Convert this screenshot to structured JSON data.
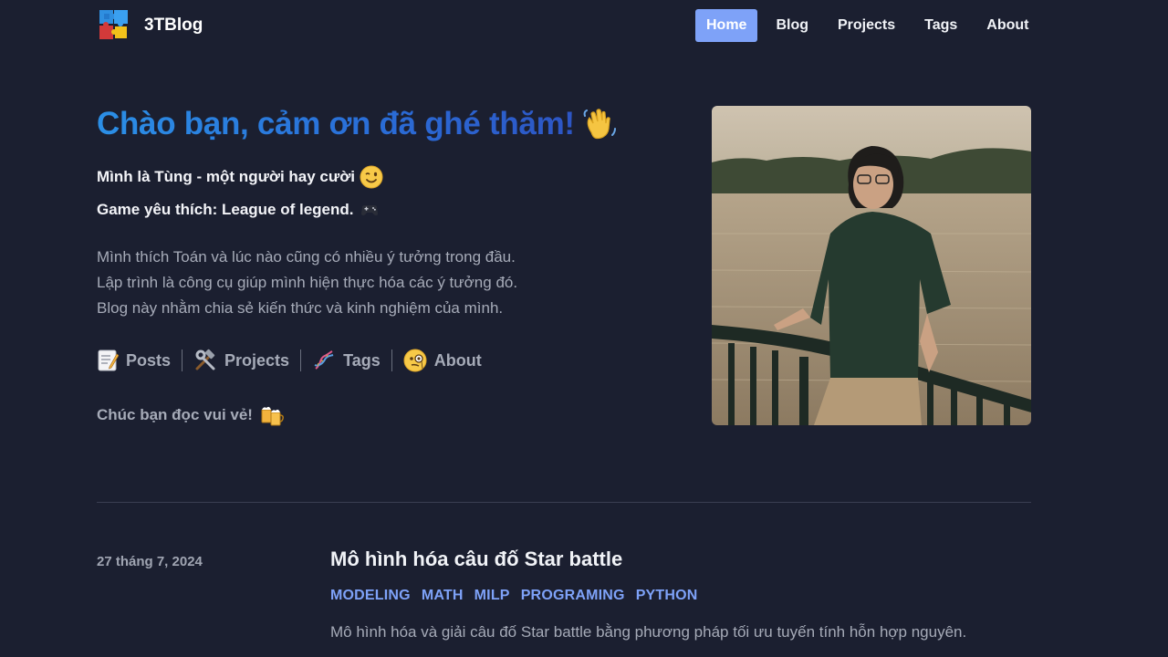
{
  "site": {
    "name": "3TBlog",
    "logo_icon": "puzzle-logo-icon"
  },
  "nav": {
    "items": [
      {
        "label": "Home",
        "active": true
      },
      {
        "label": "Blog",
        "active": false
      },
      {
        "label": "Projects",
        "active": false
      },
      {
        "label": "Tags",
        "active": false
      },
      {
        "label": "About",
        "active": false
      }
    ]
  },
  "hero": {
    "title": "Chào bạn, cảm ơn đã ghé thăm!",
    "title_icon": "waving-hand-icon",
    "line1": "Mình là Tùng - một người hay cười",
    "line1_icon": "winking-face-icon",
    "line2": "Game yêu thích: League of legend.",
    "line2_icon": "game-controller-icon",
    "intro": [
      "Mình thích Toán và lúc nào cũng có nhiều ý tưởng trong đầu.",
      "Lập trình là công cụ giúp mình hiện thực hóa các ý tưởng đó.",
      "Blog này nhằm chia sẻ kiến thức và kinh nghiệm của mình."
    ],
    "quick_links": [
      {
        "label": "Posts",
        "icon": "memo-icon"
      },
      {
        "label": "Projects",
        "icon": "hammer-wrench-icon"
      },
      {
        "label": "Tags",
        "icon": "dna-icon"
      },
      {
        "label": "About",
        "icon": "monocle-face-icon"
      }
    ],
    "closing": "Chúc bạn đọc vui vẻ!",
    "closing_icon": "beer-mugs-icon",
    "photo_icon": "profile-photo"
  },
  "posts": [
    {
      "date": "27 tháng 7, 2024",
      "title": "Mô hình hóa câu đố Star battle",
      "tags": [
        "MODELING",
        "MATH",
        "MILP",
        "PROGRAMING",
        "PYTHON"
      ],
      "summary": "Mô hình hóa và giải câu đố Star battle bằng phương pháp tối ưu tuyến tính hỗn hợp nguyên."
    }
  ],
  "colors": {
    "background": "#1b1f30",
    "accent": "#7ea2f8",
    "title_gradient_start": "#2b8fe6",
    "title_gradient_end": "#2d55c4",
    "muted_text": "#a6abb8"
  }
}
